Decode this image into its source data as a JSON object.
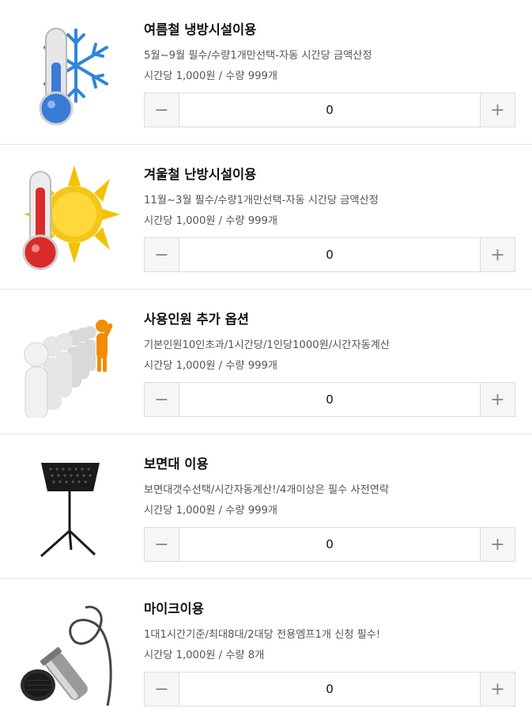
{
  "items": [
    {
      "icon": "thermometer-snowflake-icon",
      "title": "여름철 냉방시설이용",
      "desc": "5월~9월 필수/수량1개만선택-자동 시간당 금액산정",
      "price": "시간당 1,000원 / 수량 999개",
      "qty": "0"
    },
    {
      "icon": "thermometer-sun-icon",
      "title": "겨울철 난방시설이용",
      "desc": "11월~3월 필수/수량1개만선택-자동 시간당 금액산정",
      "price": "시간당 1,000원 / 수량 999개",
      "qty": "0"
    },
    {
      "icon": "people-line-icon",
      "title": "사용인원 추가 옵션",
      "desc": "기본인원10인초과/1시간당/1인당1000원/시간자동계산",
      "price": "시간당 1,000원 / 수량 999개",
      "qty": "0"
    },
    {
      "icon": "music-stand-icon",
      "title": "보면대 이용",
      "desc": "보면대갯수선택/시간자동계산!/4개이상은 필수 사전연락",
      "price": "시간당 1,000원 / 수량 999개",
      "qty": "0"
    },
    {
      "icon": "microphone-icon",
      "title": "마이크이용",
      "desc": "1대1시간기준/최대8대/2대당 전용엠프1개 신청 필수!",
      "price": "시간당 1,000원 / 수량 8개",
      "qty": "0"
    }
  ],
  "stepper": {
    "minus_label": "−",
    "plus_label": "+"
  },
  "colors": {
    "border": "#dcdcdc",
    "button_bg": "#f6f6f6",
    "cold": "#3a7bd5",
    "hot": "#d92b2b",
    "sun": "#f2c200",
    "accent_person": "#f28c00"
  }
}
